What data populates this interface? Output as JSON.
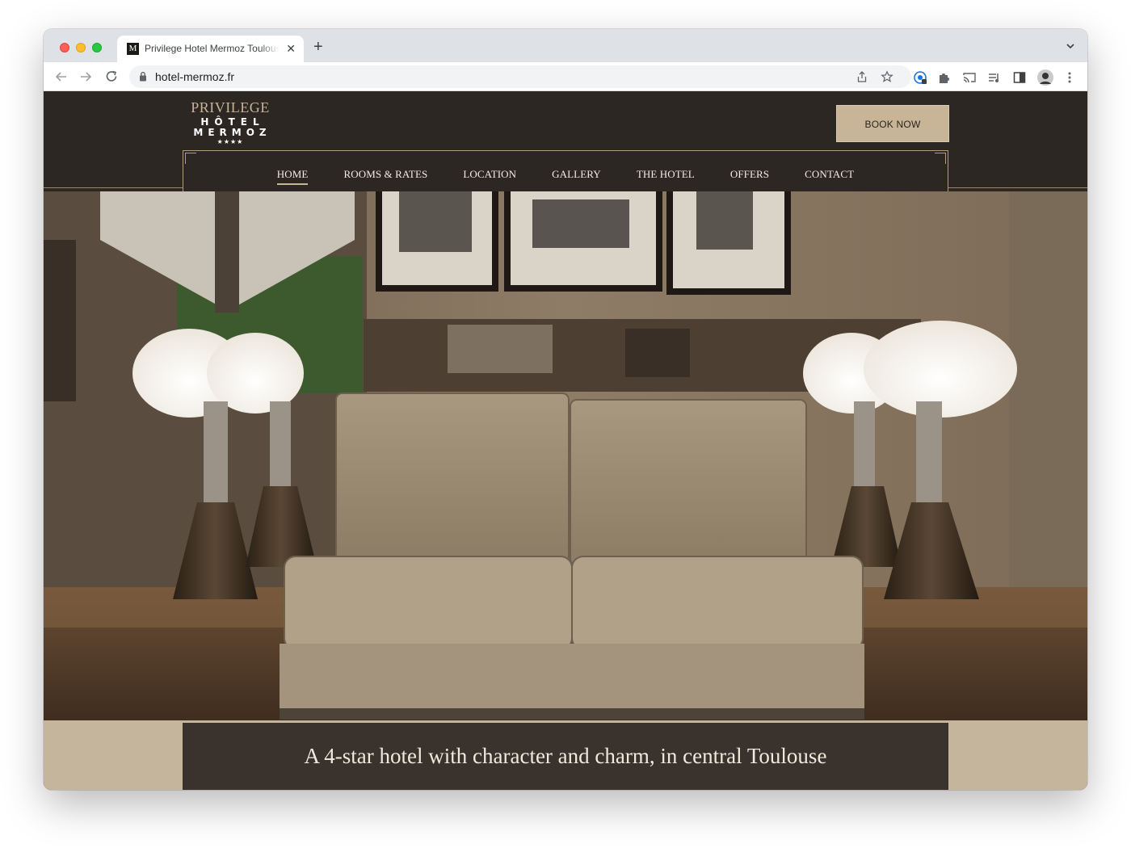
{
  "browser": {
    "tab_title": "Privilege Hotel Mermoz Toulouse",
    "tab_favicon": "M",
    "tab_close": "✕",
    "new_tab": "+",
    "url": "hotel-mermoz.fr",
    "icons": [
      "back-icon",
      "forward-icon",
      "reload-icon",
      "lock-icon",
      "share-icon",
      "star-icon",
      "extension-icon",
      "puzzle-icon",
      "cast-icon",
      "media-icon",
      "sidebar-icon",
      "profile-avatar",
      "more-icon",
      "tab-menu-icon"
    ]
  },
  "site": {
    "logo": {
      "line1": "PRIVILEGE",
      "line2": "HÔTEL",
      "line3": "MERMOZ",
      "stars": "★★★★"
    },
    "book_now": "BOOK NOW",
    "nav": {
      "home": "HOME",
      "rooms": "ROOMS & RATES",
      "location": "LOCATION",
      "gallery": "GALLERY",
      "hotel": "THE HOTEL",
      "offers": "OFFERS",
      "contact": "CONTACT"
    },
    "hero_caption": "A 4-star hotel with character and charm, in central Toulouse"
  },
  "colors": {
    "header_bg": "#2d2724",
    "accent_gold": "#c8b497",
    "nav_text": "#f3ece2"
  }
}
